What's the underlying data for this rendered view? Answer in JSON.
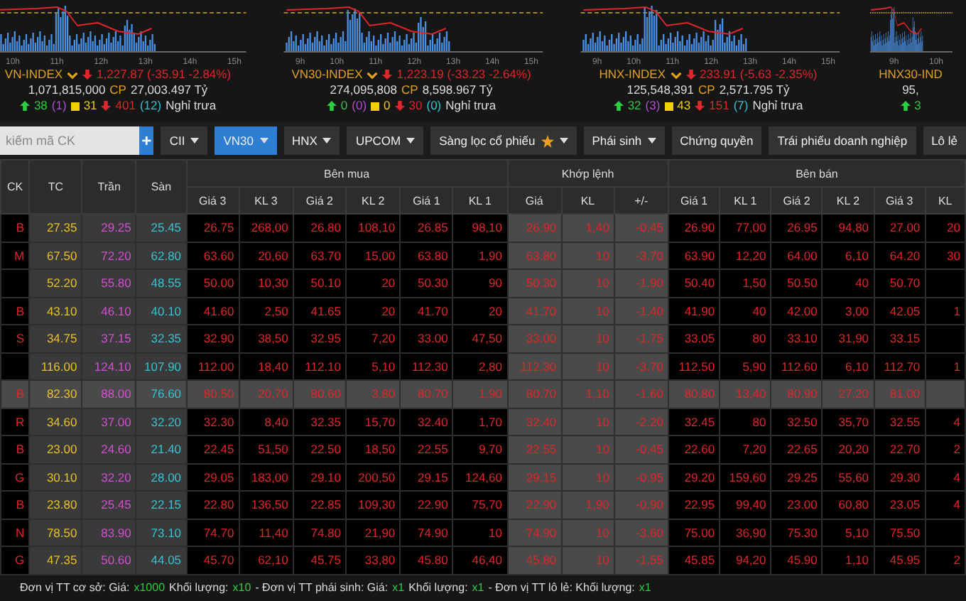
{
  "indices": [
    {
      "name": "VN-INDEX",
      "value": "1,227.87 (-35.91 -2.84%)",
      "volume": "1,071,815,000",
      "unit": "CP",
      "turnover": "27,003.497 Tỷ",
      "up": "38",
      "ceiling": "(1)",
      "unchanged": "31",
      "down": "401",
      "floor": "(12)",
      "status": "Nghỉ trưa",
      "times": [
        "10h",
        "11h",
        "12h",
        "13h",
        "14h",
        "15h"
      ]
    },
    {
      "name": "VN30-INDEX",
      "value": "1,223.19 (-33.23 -2.64%)",
      "volume": "274,095,808",
      "unit": "CP",
      "turnover": "8,598.967 Tỷ",
      "up": "0",
      "ceiling": "(0)",
      "unchanged": "0",
      "down": "30",
      "floor": "(0)",
      "status": "Nghỉ trưa",
      "times": [
        "9h",
        "10h",
        "11h",
        "12h",
        "13h",
        "14h",
        "15h"
      ]
    },
    {
      "name": "HNX-INDEX",
      "value": "233.91 (-5.63 -2.35%)",
      "volume": "125,548,391",
      "unit": "CP",
      "turnover": "2,571.795 Tỷ",
      "up": "32",
      "ceiling": "(3)",
      "unchanged": "43",
      "down": "151",
      "floor": "(7)",
      "status": "Nghỉ trưa",
      "times": [
        "9h",
        "10h",
        "11h",
        "12h",
        "13h",
        "14h",
        "15h"
      ]
    },
    {
      "name": "HNX30-IND",
      "volume": "95,",
      "up": "3",
      "times": [
        "9h",
        "10h"
      ]
    }
  ],
  "toolbar": {
    "search": {
      "placeholder": "kiếm mã CK"
    },
    "add_button": "+",
    "items": [
      {
        "kind": "dropdown",
        "label": "CII",
        "selected": false
      },
      {
        "kind": "dropdown",
        "label": "VN30",
        "selected": true
      },
      {
        "kind": "dropdown",
        "label": "HNX",
        "selected": false
      },
      {
        "kind": "dropdown",
        "label": "UPCOM",
        "selected": false
      },
      {
        "kind": "star-dropdown",
        "label": "Sàng lọc cổ phiếu",
        "selected": false
      },
      {
        "kind": "dropdown",
        "label": "Phái sinh",
        "selected": false
      },
      {
        "kind": "button",
        "label": "Chứng quyền",
        "selected": false
      },
      {
        "kind": "button",
        "label": "Trái phiếu doanh nghiệp",
        "selected": false
      },
      {
        "kind": "button",
        "label": "Lô lẻ",
        "selected": false
      }
    ]
  },
  "table": {
    "fixed_columns": [
      "CK",
      "TC",
      "Trần",
      "Sàn"
    ],
    "groups": [
      {
        "label": "Bên mua",
        "columns": [
          "Giá 3",
          "KL 3",
          "Giá 2",
          "KL 2",
          "Giá 1",
          "KL 1"
        ]
      },
      {
        "label": "Khớp lệnh",
        "columns": [
          "Giá",
          "KL",
          "+/-"
        ]
      },
      {
        "label": "Bên bán",
        "columns": [
          "Giá 1",
          "KL 1",
          "Giá 2",
          "KL 2",
          "Giá 3",
          "KL"
        ]
      }
    ],
    "rows": [
      {
        "ck": "B",
        "selected": false,
        "cells": [
          "27.35",
          "29.25",
          "25.45",
          "26.75",
          "268,00",
          "26.80",
          "108,10",
          "26.85",
          "98,10",
          "26.90",
          "1,40",
          "-0.45",
          "26.90",
          "77,00",
          "26.95",
          "94,80",
          "27.00",
          "20"
        ]
      },
      {
        "ck": "M",
        "selected": false,
        "cells": [
          "67.50",
          "72.20",
          "62.80",
          "63.60",
          "20,60",
          "63.70",
          "15,00",
          "63.80",
          "1,90",
          "63.80",
          "10",
          "-3.70",
          "63.90",
          "12,20",
          "64.00",
          "6,10",
          "64.20",
          "30"
        ]
      },
      {
        "selected": false,
        "cells": [
          "52.20",
          "55.80",
          "48.55",
          "50.00",
          "10,30",
          "50.10",
          "20",
          "50.30",
          "90",
          "50.30",
          "10",
          "-1.90",
          "50.40",
          "1,50",
          "50.50",
          "40",
          "50.70",
          null
        ]
      },
      {
        "ck": "B",
        "selected": false,
        "cells": [
          "43.10",
          "46.10",
          "40.10",
          "41.60",
          "2,50",
          "41.65",
          "20",
          "41.70",
          "20",
          "41.70",
          "10",
          "-1.40",
          "41.90",
          "40",
          "42.00",
          "3,00",
          "42.05",
          "1"
        ]
      },
      {
        "ck": "S",
        "selected": false,
        "cells": [
          "34.75",
          "37.15",
          "32.35",
          "32.90",
          "38,50",
          "32.95",
          "7,20",
          "33.00",
          "47,50",
          "33.00",
          "10",
          "-1.75",
          "33.05",
          "80",
          "33.10",
          "31,90",
          "33.15",
          null
        ]
      },
      {
        "selected": false,
        "cells": [
          "116.00",
          "124.10",
          "107.90",
          "112.00",
          "18,40",
          "112.10",
          "5,10",
          "112.30",
          "2,80",
          "112.30",
          "10",
          "-3.70",
          "112.50",
          "5,90",
          "112.60",
          "6,10",
          "112.70",
          "1"
        ]
      },
      {
        "ck": "B",
        "selected": true,
        "cells": [
          "82.30",
          "88.00",
          "76.60",
          "80.50",
          "20,70",
          "80.60",
          "3,80",
          "80.70",
          "1,90",
          "80.70",
          "1,10",
          "-1.60",
          "80.80",
          "13,40",
          "80.90",
          "27,20",
          "81.00",
          null
        ]
      },
      {
        "ck": "R",
        "selected": false,
        "cells": [
          "34.60",
          "37.00",
          "32.20",
          "32.30",
          "8,40",
          "32.35",
          "15,70",
          "32.40",
          "1,70",
          "32.40",
          "10",
          "-2.20",
          "32.45",
          "80",
          "32.50",
          "35,70",
          "32.55",
          "4"
        ]
      },
      {
        "ck": "B",
        "selected": false,
        "cells": [
          "23.00",
          "24.60",
          "21.40",
          "22.45",
          "51,50",
          "22.50",
          "18,50",
          "22.55",
          "9,70",
          "22.55",
          "10",
          "-0.45",
          "22.60",
          "7,20",
          "22.65",
          "20,20",
          "22.70",
          "2"
        ]
      },
      {
        "ck": "G",
        "selected": false,
        "cells": [
          "30.10",
          "32.20",
          "28.00",
          "29.05",
          "183,00",
          "29.10",
          "200,50",
          "29.15",
          "124,60",
          "29.15",
          "10",
          "-0.95",
          "29.20",
          "159,60",
          "29.25",
          "55,60",
          "29.30",
          "4"
        ]
      },
      {
        "ck": "B",
        "selected": false,
        "cells": [
          "23.80",
          "25.45",
          "22.15",
          "22.80",
          "136,50",
          "22.85",
          "109,30",
          "22.90",
          "75,70",
          "22.90",
          "1,90",
          "-0.90",
          "22.95",
          "99,40",
          "23.00",
          "60,80",
          "23.05",
          "4"
        ]
      },
      {
        "ck": "N",
        "selected": false,
        "cells": [
          "78.50",
          "83.90",
          "73.10",
          "74.70",
          "11,40",
          "74.80",
          "21,90",
          "74.90",
          "10",
          "74.90",
          "10",
          "-3.60",
          "75.00",
          "36,90",
          "75.30",
          "5,10",
          "75.50",
          null
        ]
      },
      {
        "ck": "G",
        "selected": false,
        "cells": [
          "47.35",
          "50.60",
          "44.05",
          "45.70",
          "62,10",
          "45.75",
          "33,80",
          "45.80",
          "46,40",
          "45.80",
          "10",
          "-1.55",
          "45.85",
          "94,20",
          "45.90",
          "1,10",
          "45.95",
          "2"
        ]
      }
    ]
  },
  "footer": [
    {
      "kind": "text",
      "text": "Đơn vị TT cơ sở: Giá:"
    },
    {
      "kind": "value",
      "text": "x1000"
    },
    {
      "kind": "text",
      "text": "Khối lượng:"
    },
    {
      "kind": "value",
      "text": "x10"
    },
    {
      "kind": "text",
      "text": "- Đơn vị TT phái sinh: Giá:"
    },
    {
      "kind": "value",
      "text": "x1"
    },
    {
      "kind": "text",
      "text": "Khối lượng:"
    },
    {
      "kind": "value",
      "text": "x1"
    },
    {
      "kind": "text",
      "text": "- Đơn vị TT lô lẻ: Khối lượng:"
    },
    {
      "kind": "value",
      "text": "x1"
    }
  ]
}
